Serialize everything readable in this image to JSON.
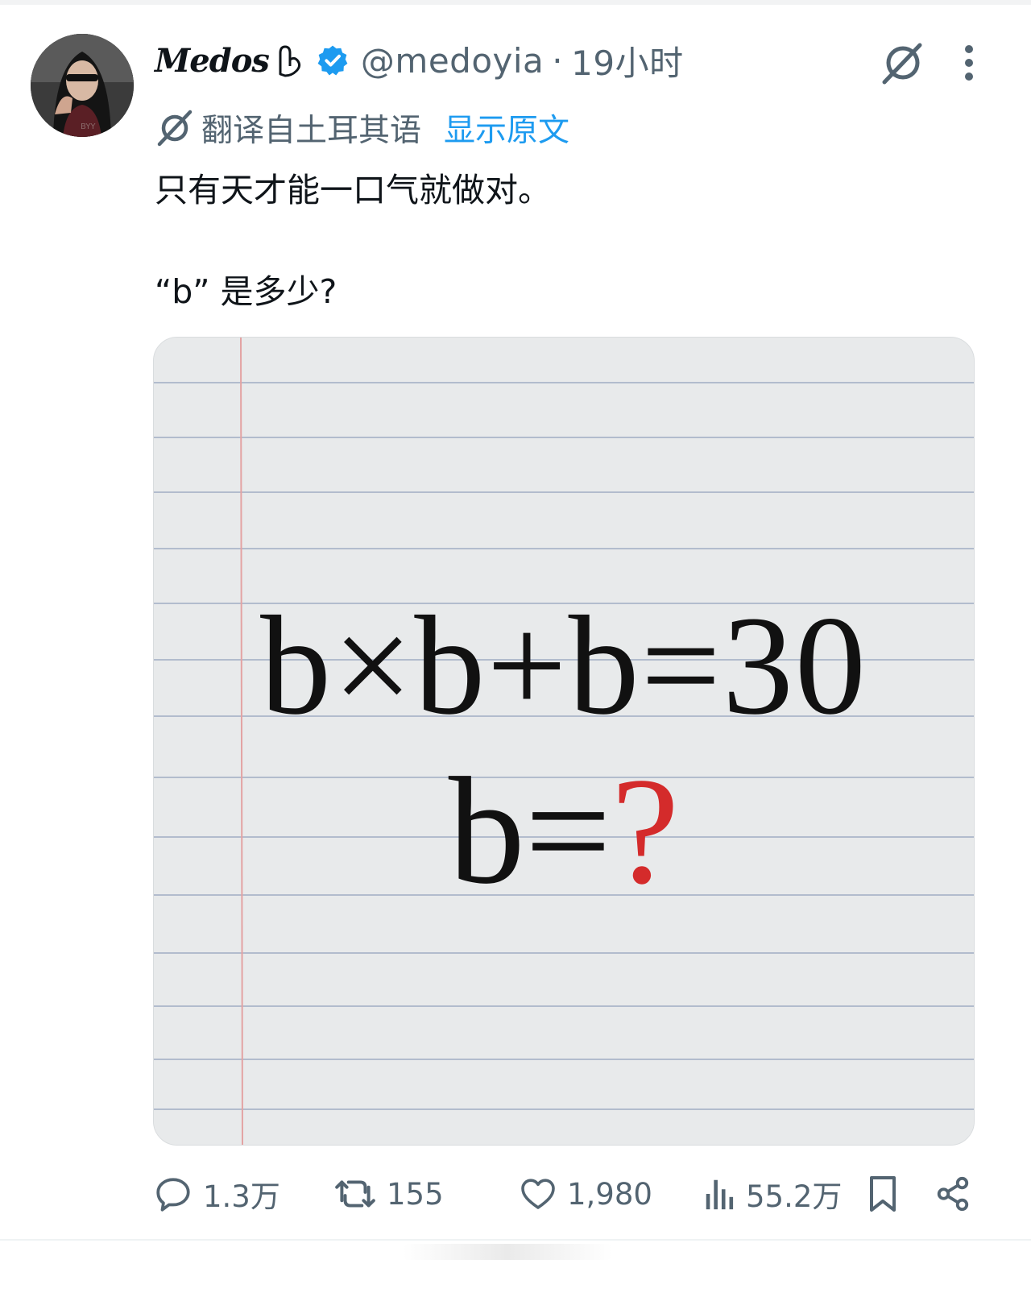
{
  "tweet": {
    "author": {
      "display_name": "Medos",
      "handle": "@medoyia",
      "verified": true,
      "avatar_icon": "avatar-photo"
    },
    "timestamp": "19小时",
    "translation": {
      "label": "翻译自土耳其语",
      "show_original": "显示原文"
    },
    "text": {
      "line1": "只有天才能一口气就做对。",
      "line2": "“b” 是多少?"
    },
    "media": {
      "equation": "b×b+b=30",
      "answer_prefix": "b=",
      "answer_mark": "?",
      "accent_color": "#d42b2b"
    },
    "actions": {
      "replies": "1.3万",
      "retweets": "155",
      "likes": "1,980",
      "views": "55.2万"
    }
  },
  "colors": {
    "link": "#1d9bf0",
    "secondary_text": "#536471",
    "primary_text": "#0f1419"
  },
  "icons": {
    "grok": "grok-icon",
    "more": "more-icon",
    "translate": "translate-icon",
    "reply": "reply-icon",
    "retweet": "retweet-icon",
    "like": "like-icon",
    "views": "views-icon",
    "bookmark": "bookmark-icon",
    "share": "share-icon"
  }
}
